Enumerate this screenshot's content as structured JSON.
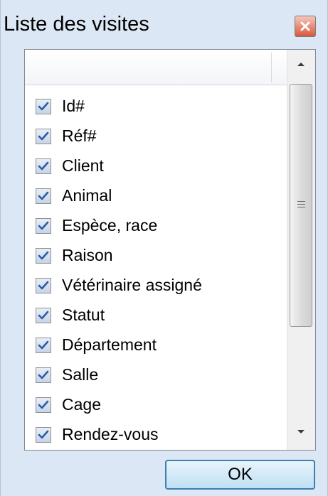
{
  "window": {
    "title": "Liste des visites"
  },
  "list": {
    "items": [
      {
        "label": "Id#",
        "checked": true
      },
      {
        "label": "Réf#",
        "checked": true
      },
      {
        "label": "Client",
        "checked": true
      },
      {
        "label": "Animal",
        "checked": true
      },
      {
        "label": "Espèce, race",
        "checked": true
      },
      {
        "label": "Raison",
        "checked": true
      },
      {
        "label": "Vétérinaire assigné",
        "checked": true
      },
      {
        "label": "Statut",
        "checked": true
      },
      {
        "label": "Département",
        "checked": true
      },
      {
        "label": "Salle",
        "checked": true
      },
      {
        "label": "Cage",
        "checked": true
      },
      {
        "label": "Rendez-vous",
        "checked": true
      }
    ]
  },
  "buttons": {
    "ok_label": "OK"
  },
  "icons": {
    "close": "close-icon",
    "checkbox": "checkmark-icon",
    "scroll_up": "arrow-up-icon",
    "scroll_down": "arrow-down-icon"
  },
  "colors": {
    "window_bg": "#dbe7f4",
    "checkmark": "#2a5da8",
    "ok_border": "#3c7fb1",
    "close_button": "#d8583e"
  }
}
